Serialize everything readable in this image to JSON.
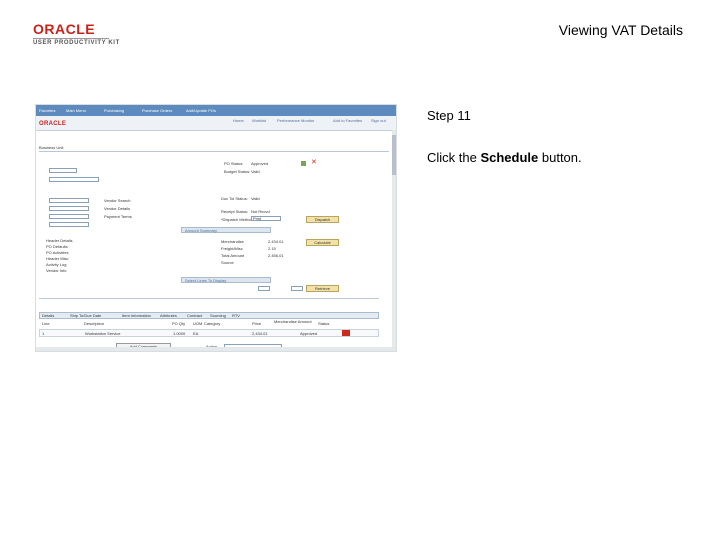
{
  "logo": {
    "wordmark": "ORACLE",
    "tagline": "USER PRODUCTIVITY KIT"
  },
  "header": {
    "title": "Viewing VAT Details"
  },
  "step": {
    "label": "Step 11"
  },
  "instruction": {
    "prefix": "Click the ",
    "target": "Schedule",
    "suffix": " button."
  },
  "screenshot": {
    "brand": "ORACLE",
    "nav": [
      "Favorites",
      "Main Menu",
      "Purchasing",
      "Purchase Orders",
      "Add/Update POs"
    ],
    "header_links": [
      "Home",
      "Worklist",
      "Performance Monitor",
      "Add to Favorites",
      "Sign out"
    ],
    "page_label": "Business Unit",
    "fields": {
      "po_status_label": "PO Status:",
      "po_status_value": "Approved",
      "budget_status_label": "Budget Status:",
      "budget_status_value": "Valid",
      "doc_tol_label": "Doc Tol Status:",
      "doc_tol_value": "Valid",
      "receipt_status_label": "Receipt Status:",
      "receipt_status_value": "Not Recvd",
      "dispatch_method_label": "*Dispatch Method:",
      "dispatch_method_value": "Print",
      "vendor_search": "Vendor Search",
      "vendor_details": "Vendor Details",
      "payment_terms": "Payment Terms"
    },
    "buttons": {
      "dispatch": "Dispatch",
      "calculate": "Calculate",
      "retrieve": "Retrieve"
    },
    "sections": {
      "amount_summary": "Amount Summary",
      "select_lines": "Select Lines To Display"
    },
    "amounts": {
      "merchandise_label": "Merchandise",
      "merchandise": "2,434.01",
      "freight_label": "Freight/Misc",
      "freight": "2.15",
      "total_label": "Total Amount",
      "total": "2,456.01",
      "source_label": "Source",
      "currency": "USD"
    },
    "left_links": [
      "Header Details",
      "PO Defaults",
      "PO Activities",
      "Header Misc",
      "Activity Log",
      "Vendor Info"
    ],
    "grid_tabs": [
      "Details",
      "Ship To/Due Date",
      "Item Information",
      "Attributes",
      "Contract",
      "Sourcing",
      "RTV"
    ],
    "grid_headers": [
      "Line",
      "Description",
      "PO Qty",
      "UOM",
      "Category",
      "Price",
      "Merchandise Amount",
      "Status"
    ],
    "grid_row": {
      "line": "1",
      "description": "Workstation Service",
      "qty": "1.0000",
      "uom": "EA",
      "price": "2,434.01",
      "status": "Approved"
    },
    "footer": {
      "add_button": "Add Comments",
      "action_label": "Action",
      "save": "Save"
    }
  }
}
